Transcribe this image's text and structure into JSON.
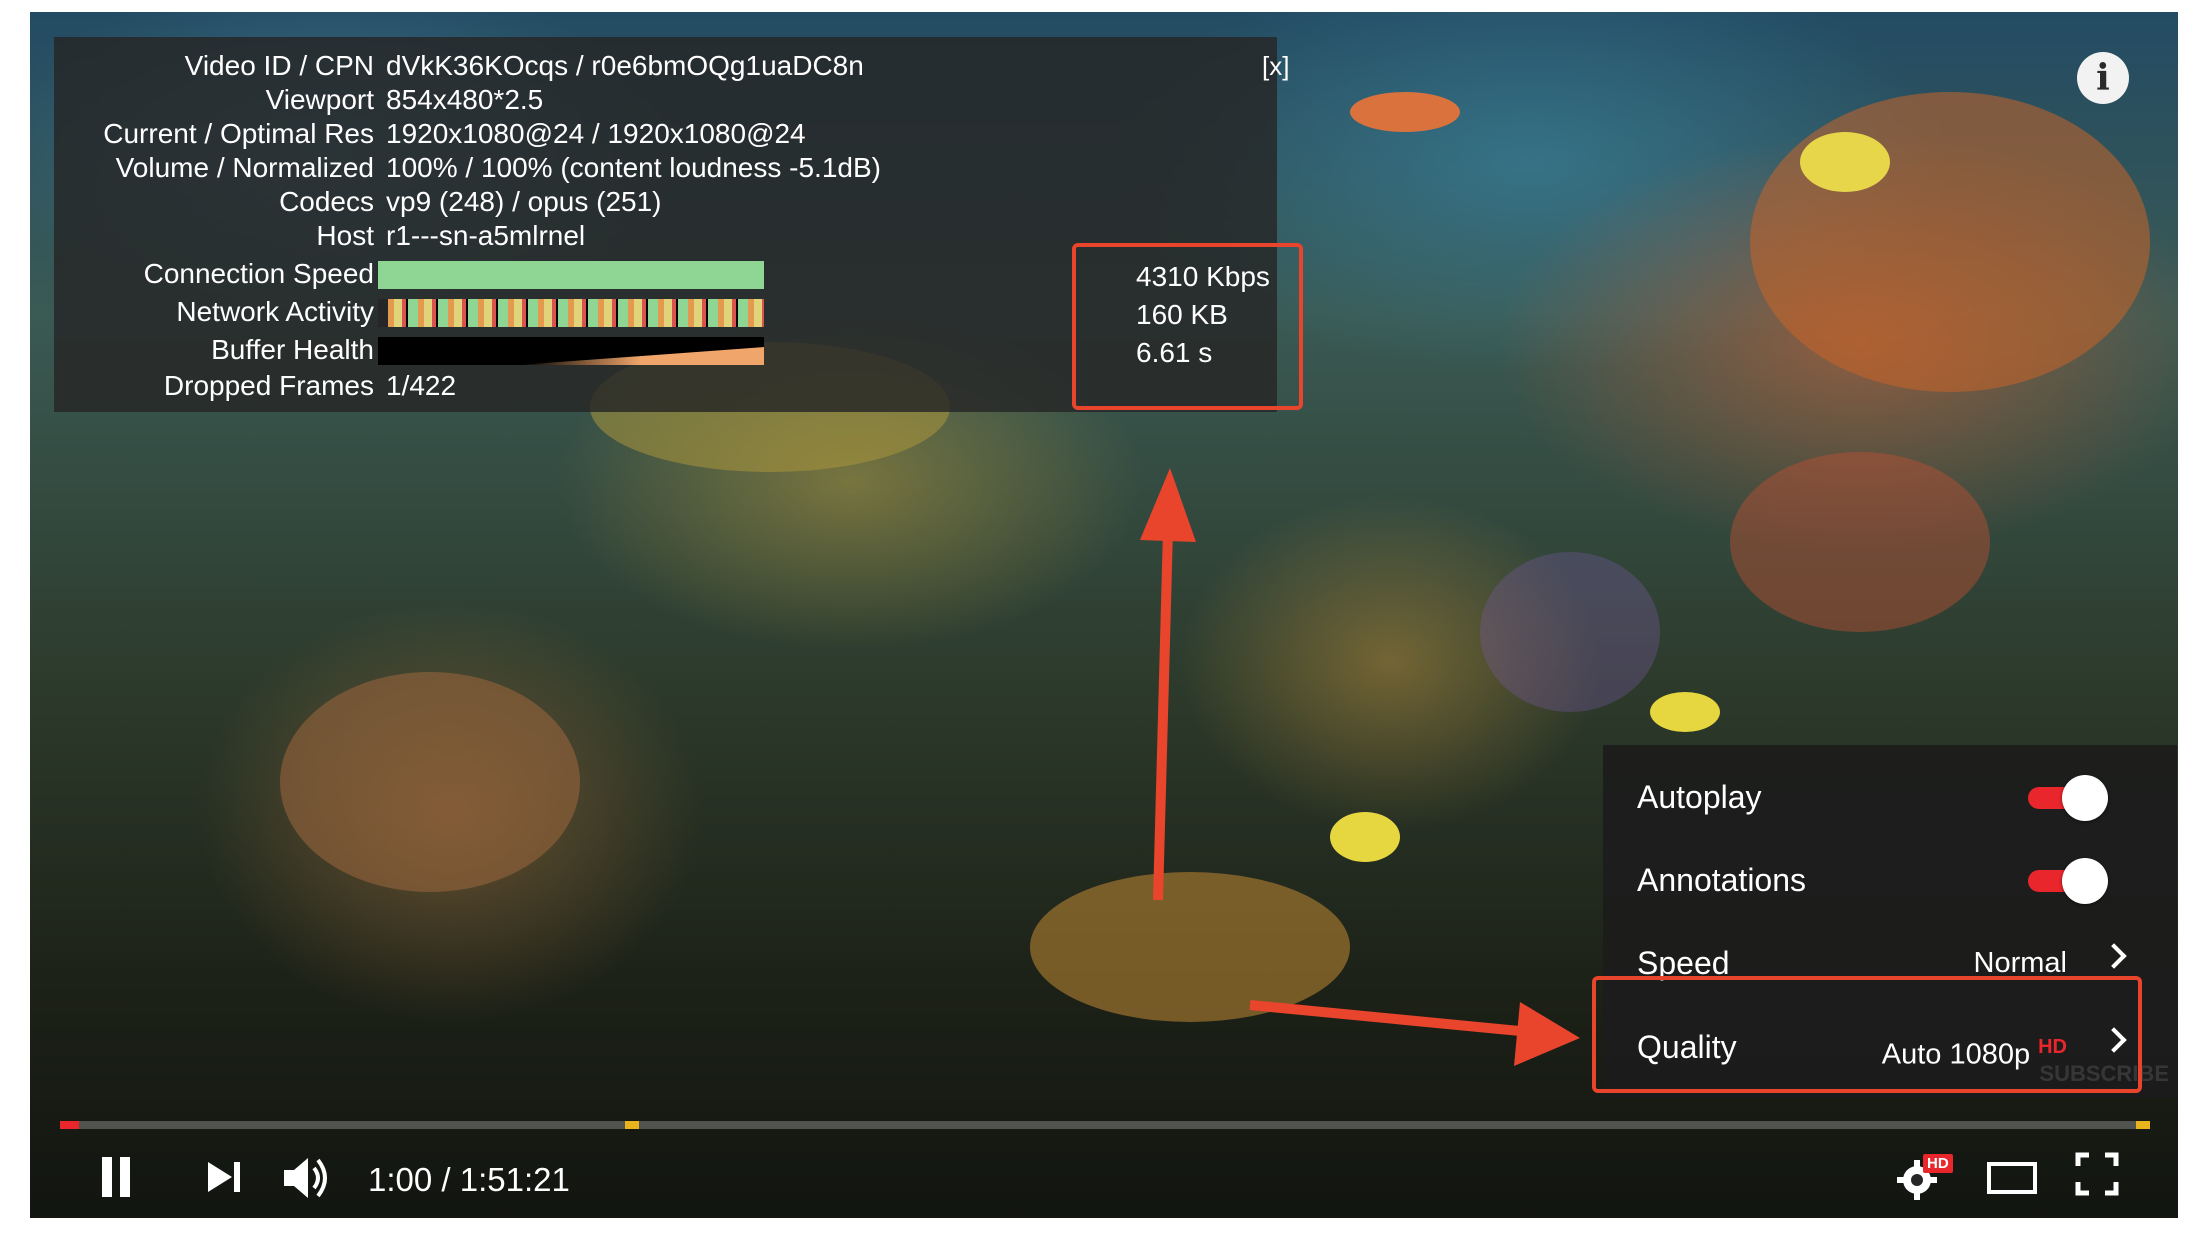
{
  "stats": {
    "close_label": "[x]",
    "rows": [
      {
        "label": "Video ID / CPN",
        "value": "dVkK36KOcqs / r0e6bmOQg1uaDC8n"
      },
      {
        "label": "Viewport",
        "value": "854x480*2.5"
      },
      {
        "label": "Current / Optimal Res",
        "value": "1920x1080@24 / 1920x1080@24"
      },
      {
        "label": "Volume / Normalized",
        "value": "100% / 100% (content loudness -5.1dB)"
      },
      {
        "label": "Codecs",
        "value": "vp9 (248) / opus (251)"
      },
      {
        "label": "Host",
        "value": "r1---sn-a5mlrnel"
      },
      {
        "label": "Connection Speed",
        "value": ""
      },
      {
        "label": "Network Activity",
        "value": ""
      },
      {
        "label": "Buffer Health",
        "value": ""
      },
      {
        "label": "Dropped Frames",
        "value": "1/422"
      }
    ],
    "connection_speed": "4310 Kbps",
    "network_activity": "160 KB",
    "buffer_health": "6.61 s",
    "colors": {
      "connection": "#8fd694",
      "network_a": "#e39a4e",
      "network_b": "#8fd694",
      "buffer": "#f0a66a"
    }
  },
  "info_button": {
    "icon": "info-icon",
    "glyph": "i"
  },
  "settings": {
    "autoplay": {
      "label": "Autoplay",
      "on": true
    },
    "annotations": {
      "label": "Annotations",
      "on": true
    },
    "speed": {
      "label": "Speed",
      "value": "Normal"
    },
    "quality": {
      "label": "Quality",
      "value": "Auto 1080p",
      "badge": "HD"
    },
    "watermark": "SUBSCRIBE"
  },
  "progress": {
    "played_fraction": 0.009
  },
  "controls": {
    "time": "1:00 / 1:51:21",
    "settings_badge": "HD",
    "icons": [
      "pause-icon",
      "next-icon",
      "volume-icon",
      "settings-gear-icon",
      "theater-mode-icon",
      "fullscreen-icon"
    ]
  },
  "accent": "#e8452c"
}
